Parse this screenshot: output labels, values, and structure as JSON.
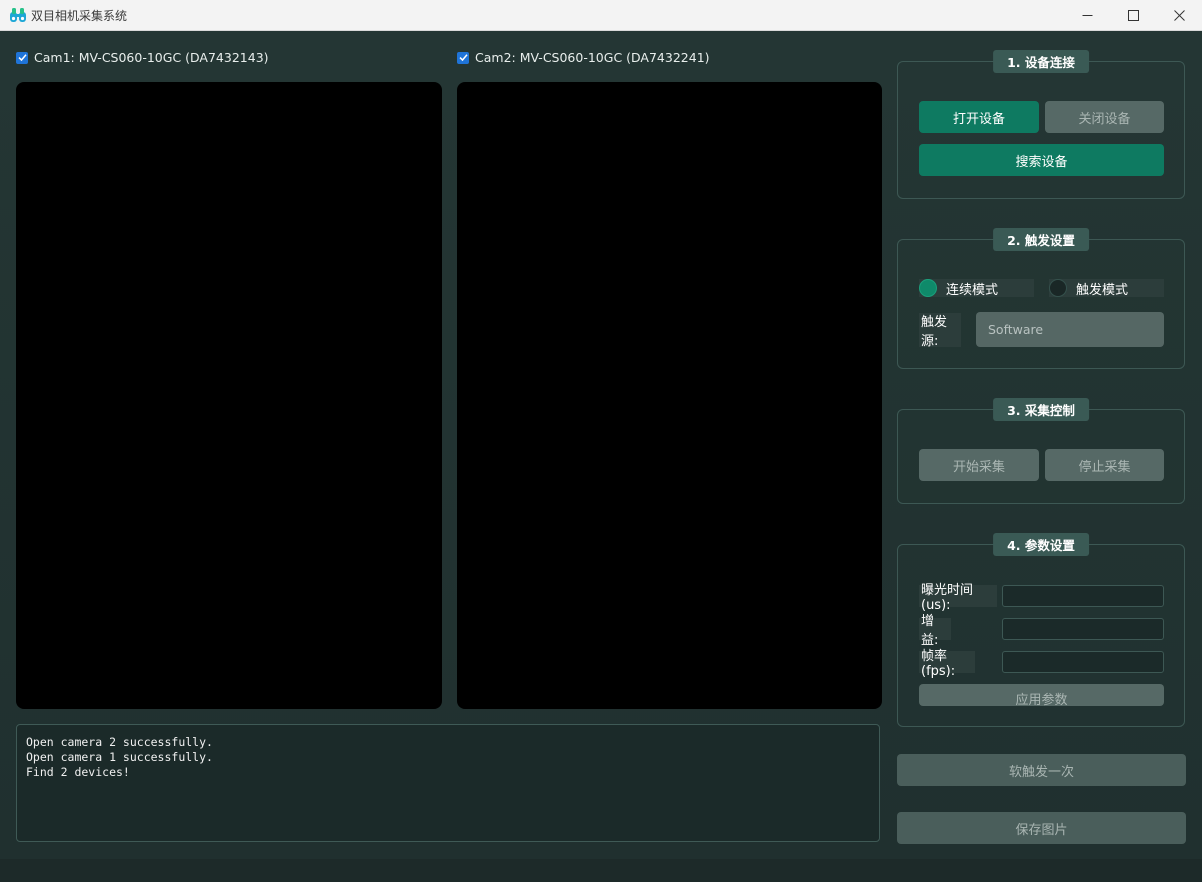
{
  "window": {
    "title": "双目相机采集系统",
    "controls": {
      "minimize": "—",
      "maximize": "☐",
      "close": "✕"
    }
  },
  "cameras": [
    {
      "label": "Cam1: MV-CS060-10GC (DA7432143)",
      "checked": true
    },
    {
      "label": "Cam2: MV-CS060-10GC (DA7432241)",
      "checked": true
    }
  ],
  "log": {
    "lines": [
      "Open camera 2 successfully.",
      "Open camera 1 successfully.",
      "Find 2 devices!"
    ]
  },
  "group1": {
    "title": "1. 设备连接",
    "open_label": "打开设备",
    "close_label": "关闭设备",
    "search_label": "搜索设备"
  },
  "group2": {
    "title": "2. 触发设置",
    "continuous_label": "连续模式",
    "trigger_label": "触发模式",
    "selected_mode": "连续模式",
    "source_label": "触发源:",
    "source_value": "Software"
  },
  "group3": {
    "title": "3. 采集控制",
    "start_label": "开始采集",
    "stop_label": "停止采集"
  },
  "group4": {
    "title": "4. 参数设置",
    "exposure_label": "曝光时间(us):",
    "gain_label": "增益:",
    "fps_label": "帧率(fps):",
    "exposure_value": "",
    "gain_value": "",
    "fps_value": "",
    "apply_label": "应用参数"
  },
  "actions": {
    "soft_trigger_label": "软触发一次",
    "save_image_label": "保存图片"
  },
  "colors": {
    "accent_green": "#0e7a61",
    "background": "#22302f",
    "disabled_button": "#566966",
    "checkbox_blue": "#1f74d8"
  }
}
